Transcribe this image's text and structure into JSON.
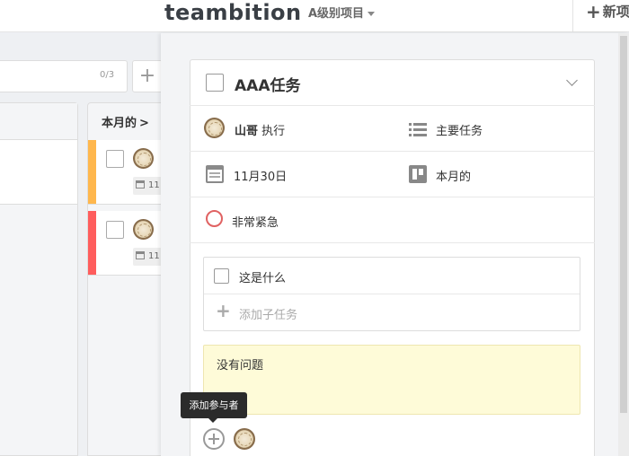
{
  "header": {
    "brand": "teambition",
    "project_name": "A级别项目",
    "new_button_label": "新项"
  },
  "board": {
    "stage_count": "0/3",
    "add_stage_label": "+",
    "column_title": "本月的",
    "column_chevron": ">",
    "cards": [
      {
        "accent": "#ffb74d",
        "date": "11"
      },
      {
        "accent": "#ff5d5d",
        "date": "11"
      }
    ]
  },
  "task": {
    "title": "AAA任务",
    "executor_name": "山哥",
    "executor_role": "执行",
    "task_type": "主要任务",
    "due_date": "11月30日",
    "stage": "本月的",
    "priority": "非常紧急",
    "subtasks": [
      {
        "label": "这是什么",
        "done": false
      }
    ],
    "add_subtask_placeholder": "添加子任务",
    "note": "没有问题",
    "add_member_tooltip": "添加参与者"
  },
  "colors": {
    "priority_urgent": "#e06262",
    "note_background": "#fefbd8"
  }
}
